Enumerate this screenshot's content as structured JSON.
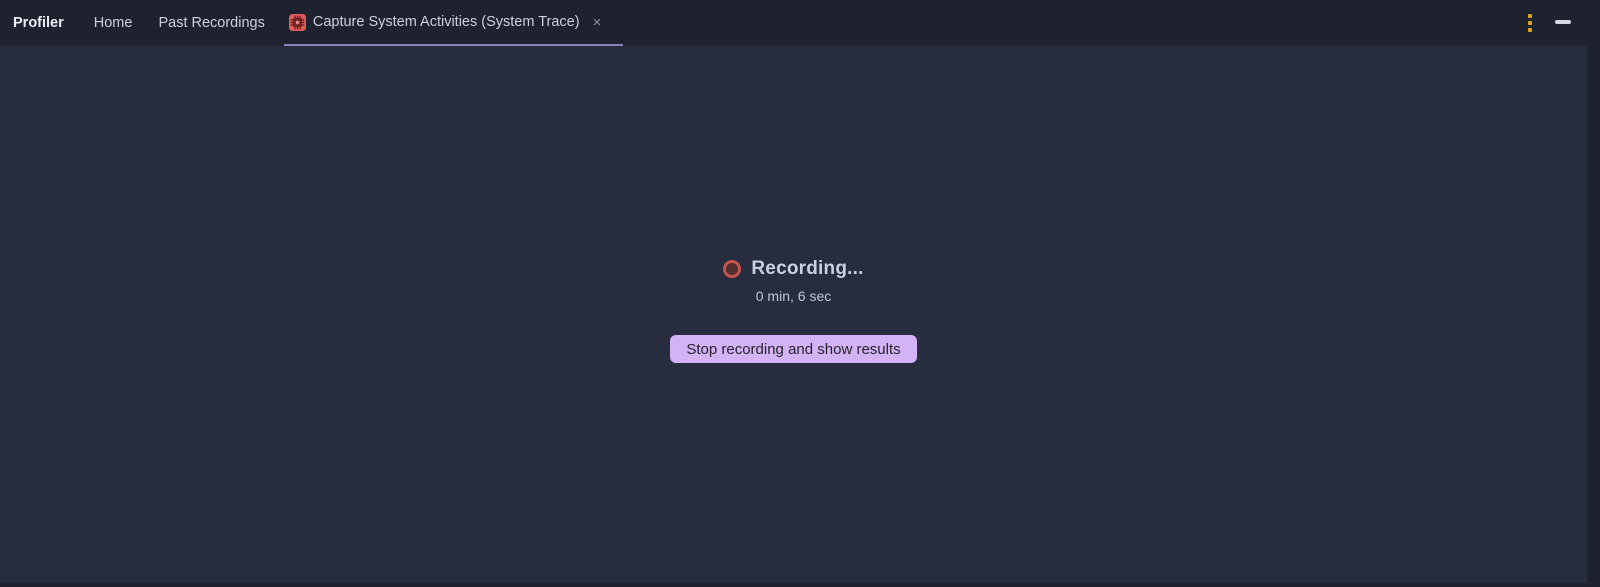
{
  "topbar": {
    "brand": "Profiler",
    "nav": [
      {
        "label": "Home"
      },
      {
        "label": "Past Recordings"
      }
    ],
    "tab": {
      "label": "Capture System Activities (System Trace)",
      "icon": "cpu-chip-icon",
      "active": true
    },
    "window_controls": {
      "menu": "kebab-menu-icon",
      "minimize": "minimize-icon"
    }
  },
  "icons": {
    "close": "×"
  },
  "main": {
    "record_icon": "record-circle-icon",
    "status": "Recording...",
    "elapsed": "0 min, 6 sec",
    "stop_button_label": "Stop recording and show results"
  },
  "colors": {
    "topbar-bg": "#1e212e",
    "content-bg": "#272c3e",
    "accent-purple": "#9181bd",
    "button-bg": "#d3b2f6",
    "button-text": "#23242c",
    "record-ring": "#c4544e",
    "record-fill": "#512f2e",
    "tab-icon-bg": "#e05d5a",
    "tab-icon-glyph": "#6d2321",
    "menu-dot": "#d9a427",
    "minimize-color": "#d6d9e1"
  }
}
